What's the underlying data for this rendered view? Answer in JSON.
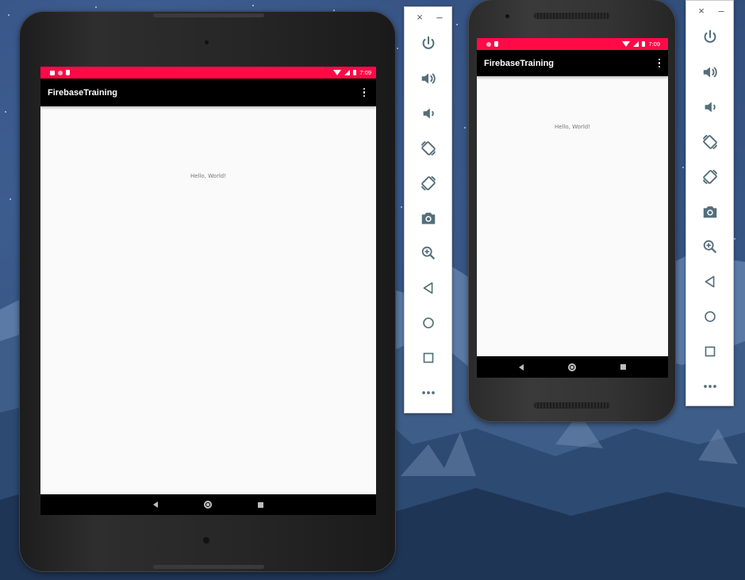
{
  "tablet": {
    "status": {
      "time": "7:09"
    },
    "app_bar": {
      "title": "FirebaseTraining"
    },
    "content": {
      "text": "Hello, World!"
    }
  },
  "phone": {
    "status": {
      "time": "7:09"
    },
    "app_bar": {
      "title": "FirebaseTraining"
    },
    "content": {
      "text": "Hello, World!"
    }
  },
  "emulator_toolbar": {
    "close_label": "×",
    "minimize_label": "–",
    "buttons": [
      "power-icon",
      "volume-up-icon",
      "volume-down-icon",
      "rotate-left-icon",
      "rotate-right-icon",
      "camera-icon",
      "zoom-icon",
      "back-icon",
      "home-icon",
      "overview-icon",
      "more-icon"
    ]
  },
  "colors": {
    "status_bar": "#ff0a47",
    "app_bar": "#000000",
    "screen_bg": "#fafafa",
    "toolbar_icon": "#546e7a"
  }
}
